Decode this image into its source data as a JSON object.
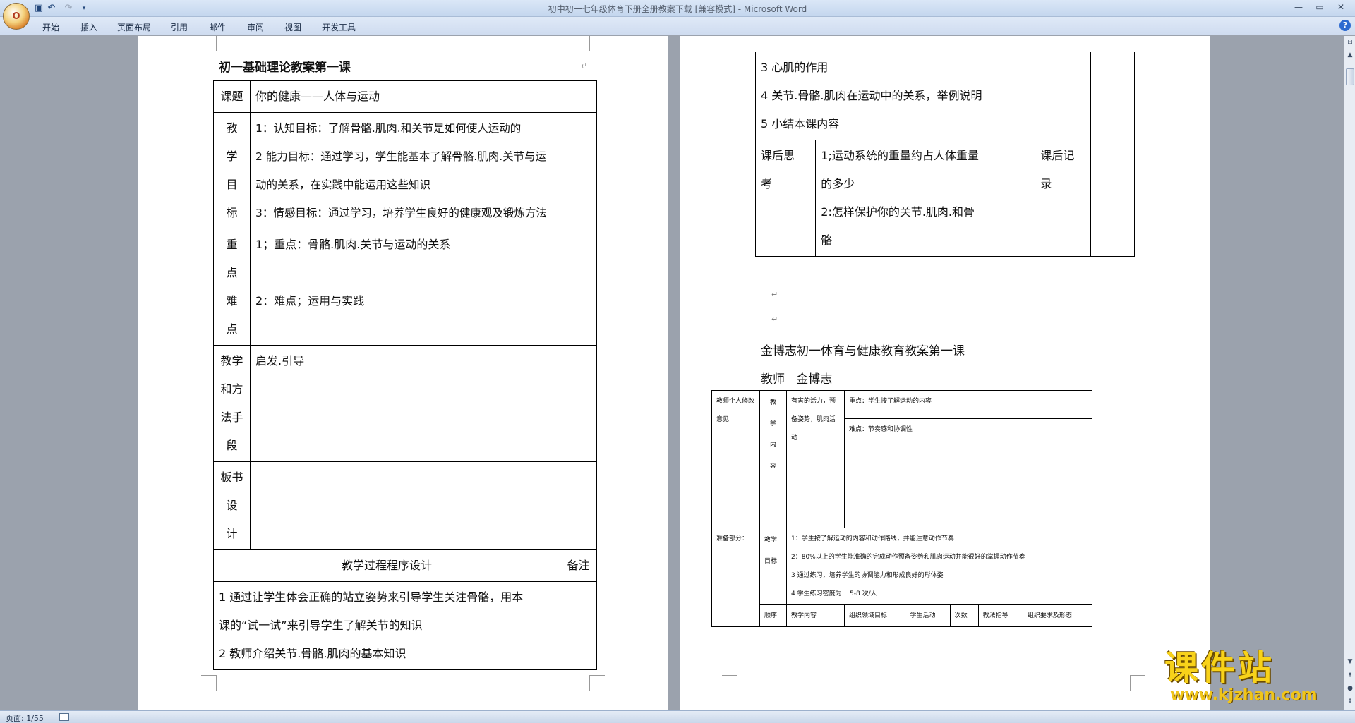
{
  "window": {
    "title": "初中初一七年级体育下册全册教案下载 [兼容模式] - Microsoft Word",
    "office_button": "O"
  },
  "ribbon": {
    "tabs": [
      "开始",
      "插入",
      "页面布局",
      "引用",
      "邮件",
      "审阅",
      "视图",
      "开发工具"
    ]
  },
  "status": {
    "page": "页面: 1/55"
  },
  "para_mark": "↵",
  "page1": {
    "heading": "初一基础理论教案第一课",
    "rows": {
      "topic": {
        "label": "课题",
        "value": "你的健康——人体与运动"
      },
      "goals": {
        "label": [
          "教",
          "学",
          "目",
          "标"
        ],
        "lines": [
          "1：认知目标：了解骨骼.肌肉.和关节是如何使人运动的",
          "2 能力目标：通过学习，学生能基本了解骨骼.肌肉.关节与运",
          "动的关系，在实践中能运用这些知识",
          "3：情感目标：通过学习，培养学生良好的健康观及锻炼方法"
        ]
      },
      "key": {
        "label": [
          "重",
          "点",
          "难",
          "点"
        ],
        "lines": [
          "1；重点：骨骼.肌肉.关节与运动的关系",
          "",
          "2：难点；运用与实践"
        ]
      },
      "method": {
        "label": [
          "教学",
          "和方",
          "法手",
          "段"
        ],
        "value": "启发.引导"
      },
      "board": {
        "label": [
          "板书",
          "设",
          "计"
        ],
        "value": ""
      },
      "process": {
        "header": "教学过程程序设计",
        "remark": "备注",
        "lines": [
          "1 通过让学生体会正确的站立姿势来引导学生关注骨骼，用本",
          "课的“试一试”来引导学生了解关节的知识",
          "2 教师介绍关节.骨骼.肌肉的基本知识"
        ]
      }
    }
  },
  "page2": {
    "cont_lines": [
      "3 心肌的作用",
      "4 关节.骨骼.肌肉在运动中的关系，举例说明",
      "5 小结本课内容"
    ],
    "after": {
      "label": [
        "课后思",
        "考"
      ],
      "lines": [
        "1;运动系统的重量约占人体重量",
        "的多少",
        "2:怎样保护你的关节.肌肉.和骨",
        "骼"
      ],
      "record_label": [
        "课后记",
        "录"
      ]
    },
    "title2": "金博志初一体育与健康教育教案第一课",
    "teacher": "教师   金博志",
    "small": {
      "teacher_opinion": "教师个人修改意见",
      "content_label": [
        "教",
        "学",
        "内",
        "容"
      ],
      "content_value": "有害的活力，预备姿势，肌肉活动",
      "key": "重点：学生按了解运动的内容",
      "difficult": "难点：节奏感和协调性",
      "prep": "准备部分：",
      "goal_label": [
        "教学",
        "目标"
      ],
      "goals": [
        "1：学生按了解运动的内容和动作路线，并能注意动作节奏",
        "2：80%以上的学生能准确的完成动作预备姿势和肌肉运动并能很好的掌握动作节奏",
        "3 通过练习，培养学生的协调能力和形成良好的形体姿",
        "4 学生练习密度为    5-8 次/人"
      ],
      "cols": [
        "顺序",
        "教学内容",
        "组织领域目标",
        "学生活动",
        "次数",
        "教法指导",
        "组织要求及形态"
      ]
    }
  },
  "watermark": {
    "title": "课件站",
    "url": "www.kjzhan.com"
  }
}
